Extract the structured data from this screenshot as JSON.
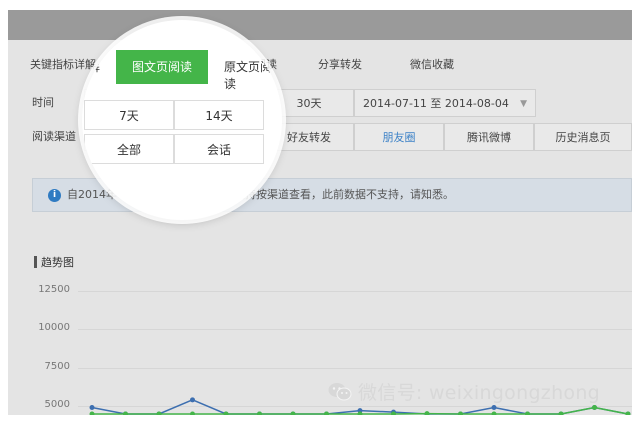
{
  "tabs": [
    "关键指标详解",
    "图文页阅读",
    "原文页阅读",
    "分享转发",
    "微信收藏"
  ],
  "time_row": {
    "label": "时间",
    "options": [
      "7天",
      "14天",
      "30天"
    ],
    "date_range": "2014-07-11 至 2014-08-04"
  },
  "channel_row": {
    "label": "阅读渠道",
    "options": [
      "全部",
      "会话",
      "好友转发",
      "朋友圈",
      "腾讯微博",
      "历史消息页"
    ]
  },
  "notice": {
    "icon": "info-icon",
    "text": "自2014年8月起，图文页阅读数据支持按渠道查看，此前数据不支持，请知悉。"
  },
  "trend_title": "趋势图",
  "chart_data": {
    "type": "line",
    "yticks": [
      "12500",
      "10000",
      "7500",
      "5000"
    ],
    "ylim": [
      4000,
      12500
    ],
    "series": [
      {
        "color": "#3d6fb0",
        "values": [
          4900,
          4350,
          4150,
          5400,
          4000,
          4300,
          4050,
          4250,
          4700,
          4600,
          4100,
          4300,
          4900,
          4400,
          4050,
          4900,
          4200
        ]
      },
      {
        "color": "#44b549",
        "values": [
          4000,
          4000,
          4000,
          4000,
          4000,
          4000,
          4000,
          4000,
          4000,
          4000,
          4500,
          4000,
          4000,
          4000,
          4000,
          4900,
          4000
        ]
      }
    ]
  },
  "watermark": "微信号: weixingongzhong",
  "colors": {
    "accent": "#44b549",
    "link": "#3d82c7",
    "info": "#2f7bc2"
  }
}
